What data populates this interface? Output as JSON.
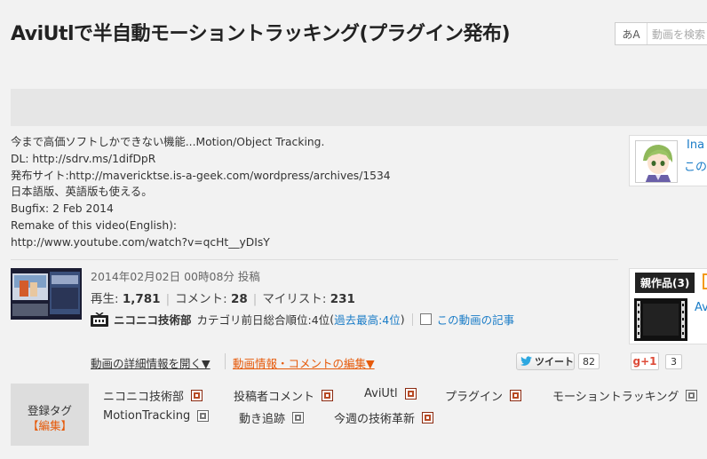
{
  "video": {
    "title": "AviUtlで半自動モーショントラッキング(プラグイン発布)",
    "description": [
      "今まで高価ソフトしかできない機能...Motion/Object Tracking.",
      "DL: http://sdrv.ms/1difDpR",
      "発布サイト:http://mavericktse.is-a-geek.com/wordpress/archives/1534",
      "日本語版、英語版も使える。",
      "Bugfix: 2 Feb 2014",
      "Remake of this video(English):",
      "http://www.youtube.com/watch?v=qcHt__yDIsY"
    ],
    "post_date": "2014年02月02日 00時08分 投稿",
    "stats": {
      "views_label": "再生:",
      "views": "1,781",
      "comments_label": "コメント:",
      "comments": "28",
      "mylists_label": "マイリスト:",
      "mylists": "231"
    },
    "channel": {
      "name": "ニコニコ技術部",
      "ranking_text": "カテゴリ前日総合順位:4位",
      "ranking_best": "過去最高:4位",
      "article_link": "この動画の記事"
    },
    "detail_link": "動画の詳細情報を開く▼",
    "edit_link": "動画情報・コメントの編集▼"
  },
  "search": {
    "ime": "あA",
    "placeholder": "動画を検索"
  },
  "uploader": {
    "name": "Ina",
    "link": "この"
  },
  "parent": {
    "label": "親作品(3)",
    "link": "Av"
  },
  "social": {
    "tweet_label": "ツイート",
    "tweet_count": "82",
    "gplus_label": "g+1",
    "gplus_count": "3"
  },
  "tags": {
    "label": "登録タグ",
    "edit": "【編集】",
    "items": [
      {
        "text": "ニコニコ技術部",
        "dic": "red"
      },
      {
        "text": "投稿者コメント",
        "dic": "red"
      },
      {
        "text": "AviUtl",
        "dic": "red"
      },
      {
        "text": "プラグイン",
        "dic": "red"
      },
      {
        "text": "モーショントラッキング",
        "dic": "gray"
      },
      {
        "text": "MotionTracking",
        "dic": "gray"
      },
      {
        "text": "動き追跡",
        "dic": "gray"
      },
      {
        "text": "今週の技術革新",
        "dic": "red"
      }
    ]
  },
  "colors": {
    "link": "#1a7cc7",
    "edit_orange": "#e65a0a",
    "tag_dic_red": "#b84a24"
  }
}
